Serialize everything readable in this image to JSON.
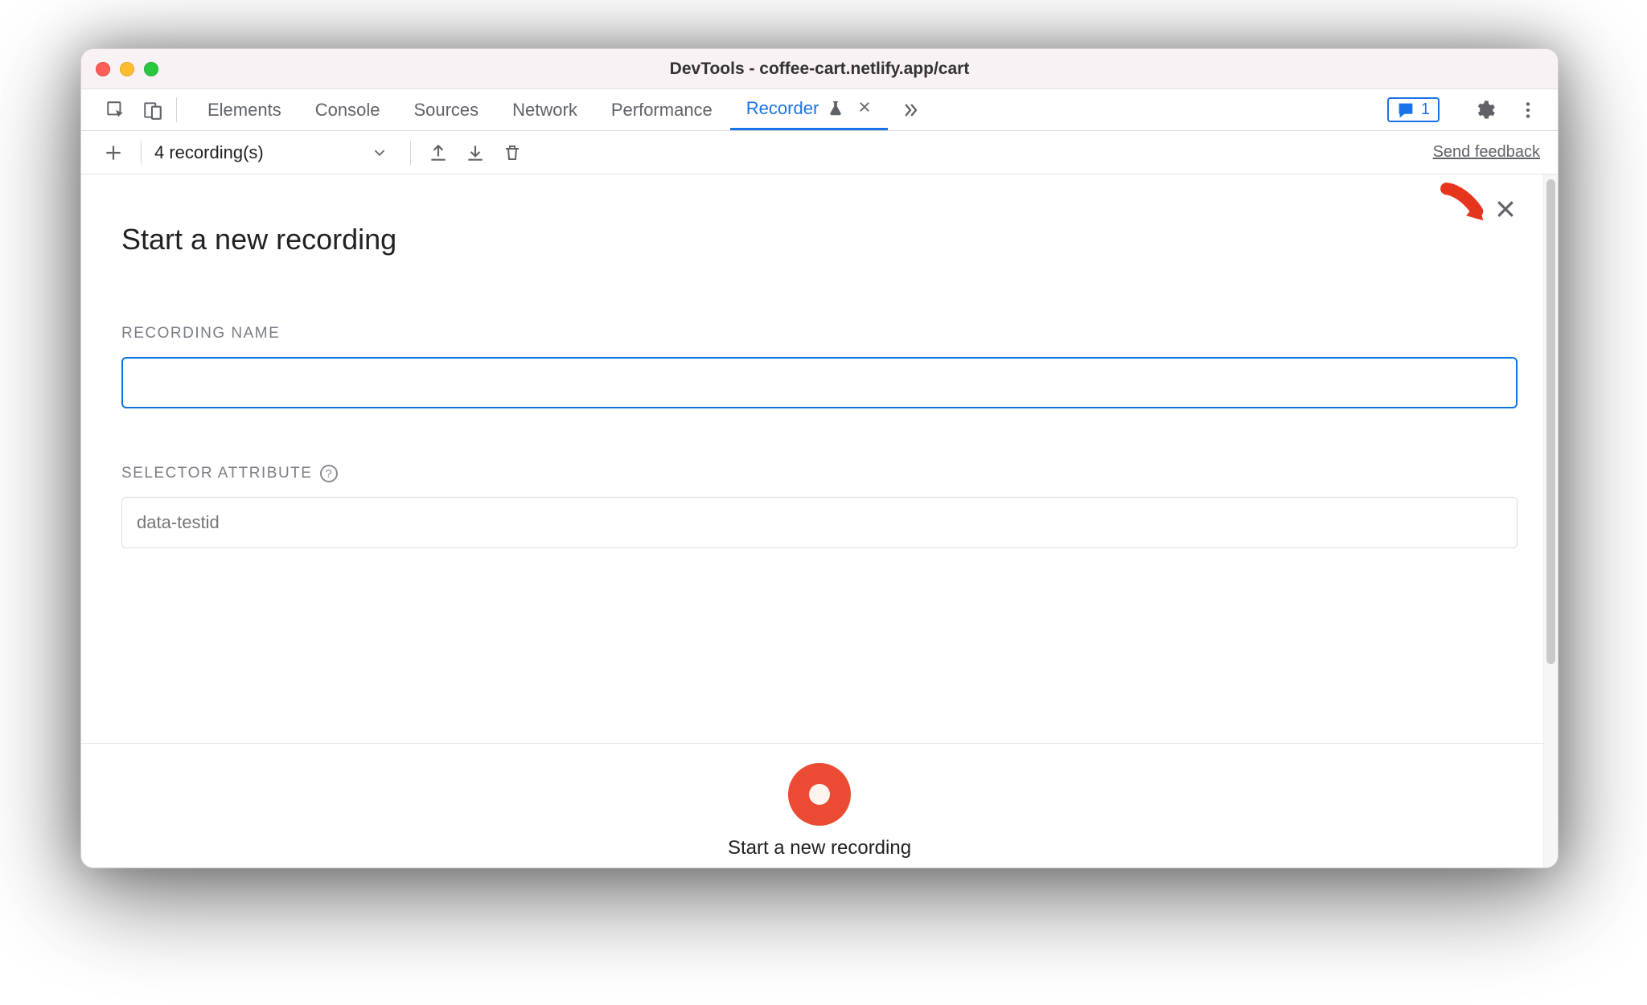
{
  "window": {
    "title": "DevTools - coffee-cart.netlify.app/cart"
  },
  "tabs": {
    "items": [
      "Elements",
      "Console",
      "Sources",
      "Network",
      "Performance",
      "Recorder"
    ],
    "active_index": 5,
    "issues_count": "1"
  },
  "toolbar": {
    "recordings_label": "4 recording(s)",
    "feedback_label": "Send feedback"
  },
  "panel": {
    "heading": "Start a new recording",
    "recording_name_label": "RECORDING NAME",
    "recording_name_value": "",
    "selector_attr_label": "SELECTOR ATTRIBUTE",
    "selector_attr_placeholder": "data-testid",
    "record_button_label": "Start a new recording"
  },
  "icons": {
    "inspect": "inspect-icon",
    "device": "device-toolbar-icon",
    "flask": "flask-icon",
    "close_tab": "close-icon",
    "overflow": "chevrons-right-icon",
    "chat": "chat-icon",
    "gear": "gear-icon",
    "kebab": "more-vertical-icon",
    "plus": "plus-icon",
    "chevron_down": "chevron-down-icon",
    "upload": "upload-icon",
    "download": "download-icon",
    "trash": "trash-icon",
    "help": "help-circle-icon",
    "record": "record-icon",
    "close_panel": "close-icon",
    "arrow_annotation": "arrow-annotation"
  },
  "colors": {
    "accent_blue": "#1a73e8",
    "record_red": "#ea4b32",
    "annotation_red": "#e6351f"
  }
}
